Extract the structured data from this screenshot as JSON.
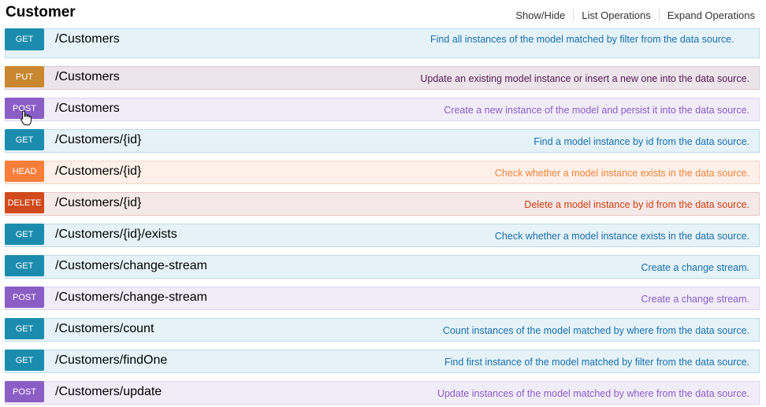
{
  "resource": {
    "title": "Customer",
    "links": [
      "Show/Hide",
      "List Operations",
      "Expand Operations"
    ]
  },
  "operations": [
    {
      "method": "GET",
      "path": "/Customers",
      "description": "Find all instances of the model matched by filter from the data source."
    },
    {
      "method": "PUT",
      "path": "/Customers",
      "description": "Update an existing model instance or insert a new one into the data source."
    },
    {
      "method": "POST",
      "path": "/Customers",
      "description": "Create a new instance of the model and persist it into the data source."
    },
    {
      "method": "GET",
      "path": "/Customers/{id}",
      "description": "Find a model instance by id from the data source."
    },
    {
      "method": "HEAD",
      "path": "/Customers/{id}",
      "description": "Check whether a model instance exists in the data source."
    },
    {
      "method": "DELETE",
      "path": "/Customers/{id}",
      "description": "Delete a model instance by id from the data source."
    },
    {
      "method": "GET",
      "path": "/Customers/{id}/exists",
      "description": "Check whether a model instance exists in the data source."
    },
    {
      "method": "GET",
      "path": "/Customers/change-stream",
      "description": "Create a change stream."
    },
    {
      "method": "POST",
      "path": "/Customers/change-stream",
      "description": "Create a change stream."
    },
    {
      "method": "GET",
      "path": "/Customers/count",
      "description": "Count instances of the model matched by where from the data source."
    },
    {
      "method": "GET",
      "path": "/Customers/findOne",
      "description": "Find first instance of the model matched by filter from the data source."
    },
    {
      "method": "POST",
      "path": "/Customers/update",
      "description": "Update instances of the model matched by where from the data source."
    }
  ]
}
